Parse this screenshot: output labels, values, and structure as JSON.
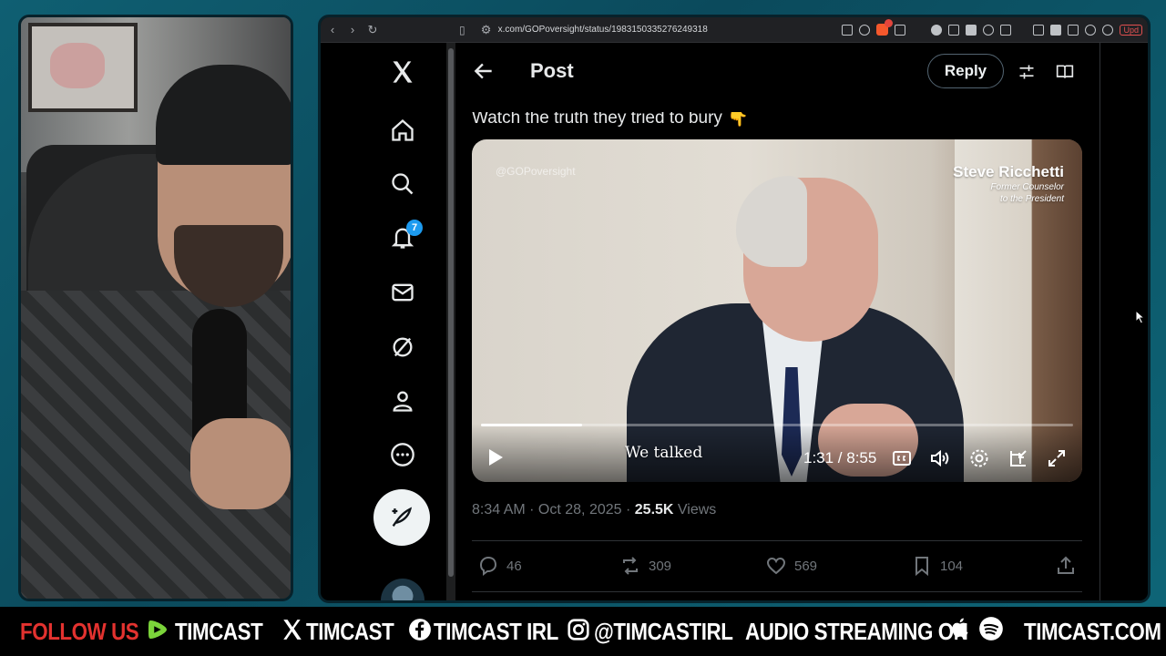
{
  "browser": {
    "url": "x.com/GOPoversight/status/1983150335276249318",
    "update_label": "Upd"
  },
  "nav": {
    "notifications_count": "7"
  },
  "post": {
    "header_title": "Post",
    "reply_label": "Reply",
    "text": "Watch the truth they tried to bury 👇",
    "video": {
      "watermark": "@GOPoversight",
      "person_name": "Steve Ricchetti",
      "person_role_line1": "Former Counselor",
      "person_role_line2": "to the President",
      "caption": "We talked",
      "time": "1:31 / 8:55",
      "progress_fraction": 0.17
    },
    "timestamp": "8:34 AM · Oct 28, 2025 · ",
    "views_count": "25.5K",
    "views_label": " Views",
    "replies": "46",
    "reposts": "309",
    "likes": "569",
    "bookmarks": "104"
  },
  "banner": {
    "follow_us": "FOLLOW US",
    "rumble": "TIMCAST",
    "x": "TIMCAST",
    "facebook": "TIMCAST IRL",
    "instagram": "@TIMCASTIRL",
    "audio": "AUDIO STREAMING ON",
    "site": "TIMCAST.COM"
  },
  "colors": {
    "accent": "#1d9bf0",
    "banner_red": "#e3322f",
    "background_teal": "#0f5f72"
  }
}
